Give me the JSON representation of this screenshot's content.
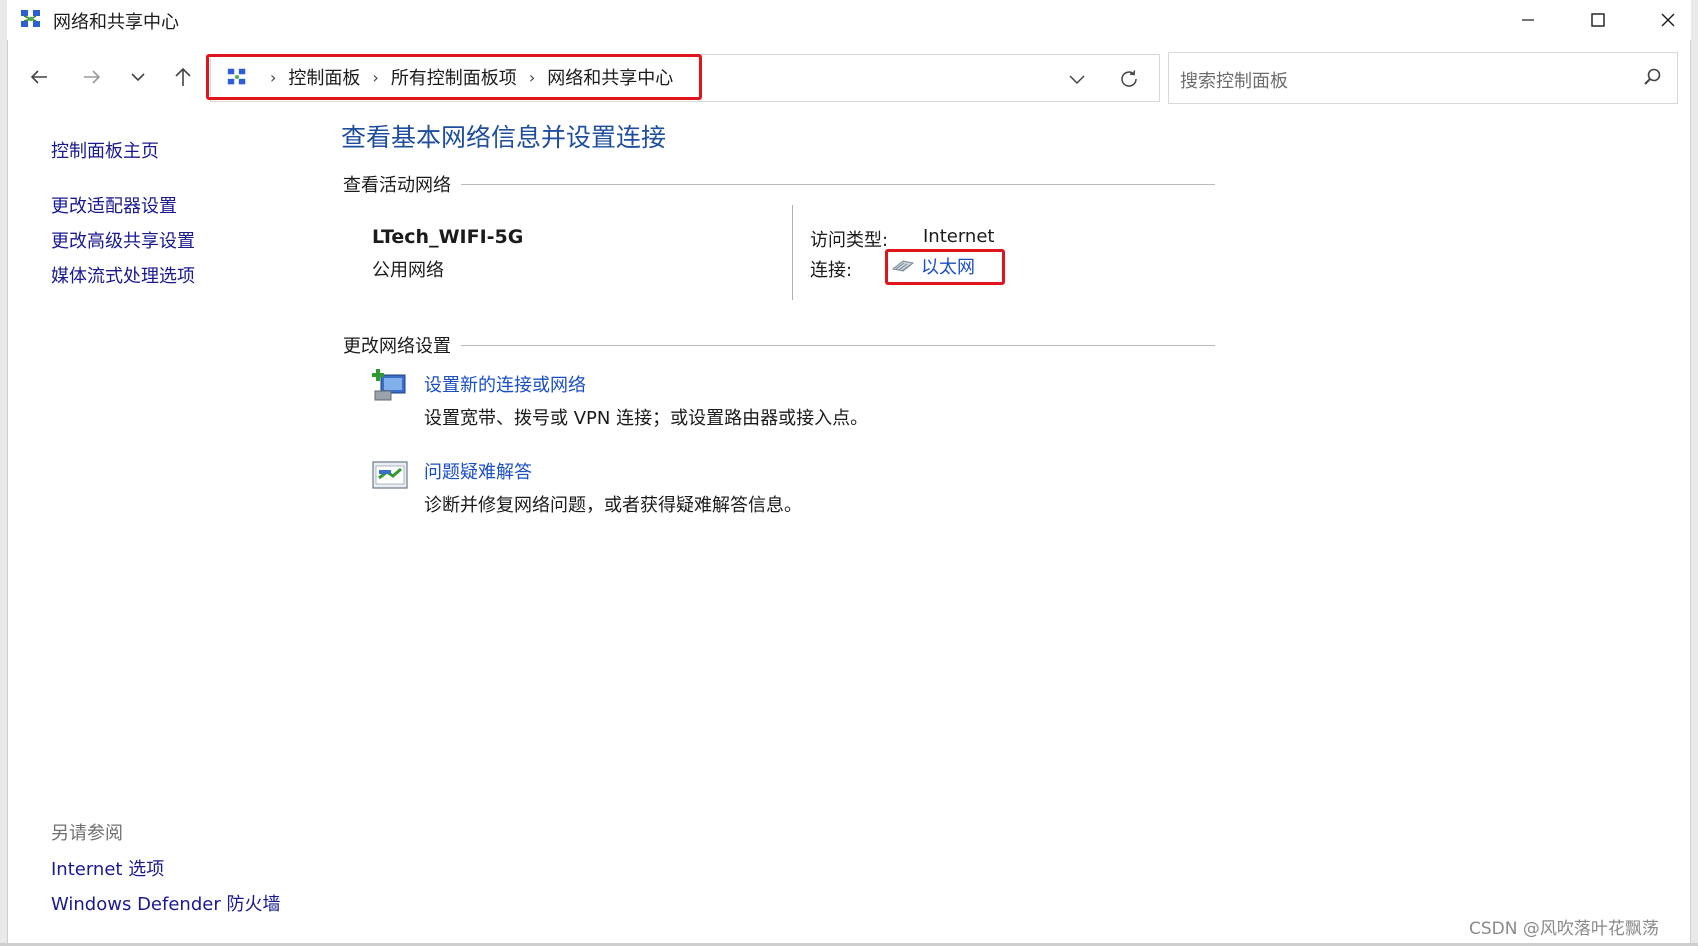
{
  "window": {
    "title": "网络和共享中心"
  },
  "address": {
    "crumbs": [
      "控制面板",
      "所有控制面板项",
      "网络和共享中心"
    ],
    "search_placeholder": "搜索控制面板"
  },
  "leftnav": {
    "home": "控制面板主页",
    "items": [
      "更改适配器设置",
      "更改高级共享设置",
      "媒体流式处理选项"
    ],
    "see_also_title": "另请参阅",
    "see_also": [
      "Internet 选项",
      "Windows Defender 防火墙"
    ]
  },
  "main": {
    "heading": "查看基本网络信息并设置连接",
    "active_networks_title": "查看活动网络",
    "network": {
      "name": "LTech_WIFI-5G",
      "type": "公用网络",
      "access_type_label": "访问类型:",
      "access_type_value": "Internet",
      "connection_label": "连接:",
      "connection_value": "以太网"
    },
    "change_settings_title": "更改网络设置",
    "tasks": [
      {
        "link": "设置新的连接或网络",
        "desc": "设置宽带、拨号或 VPN 连接；或设置路由器或接入点。",
        "icon": "new-connection-icon"
      },
      {
        "link": "问题疑难解答",
        "desc": "诊断并修复网络问题，或者获得疑难解答信息。",
        "icon": "troubleshoot-icon"
      }
    ]
  },
  "watermark": "CSDN @风吹落叶花飘荡",
  "colors": {
    "highlight_border": "#e0141c",
    "link": "#1a4fc4",
    "heading": "#1e4e9c"
  }
}
